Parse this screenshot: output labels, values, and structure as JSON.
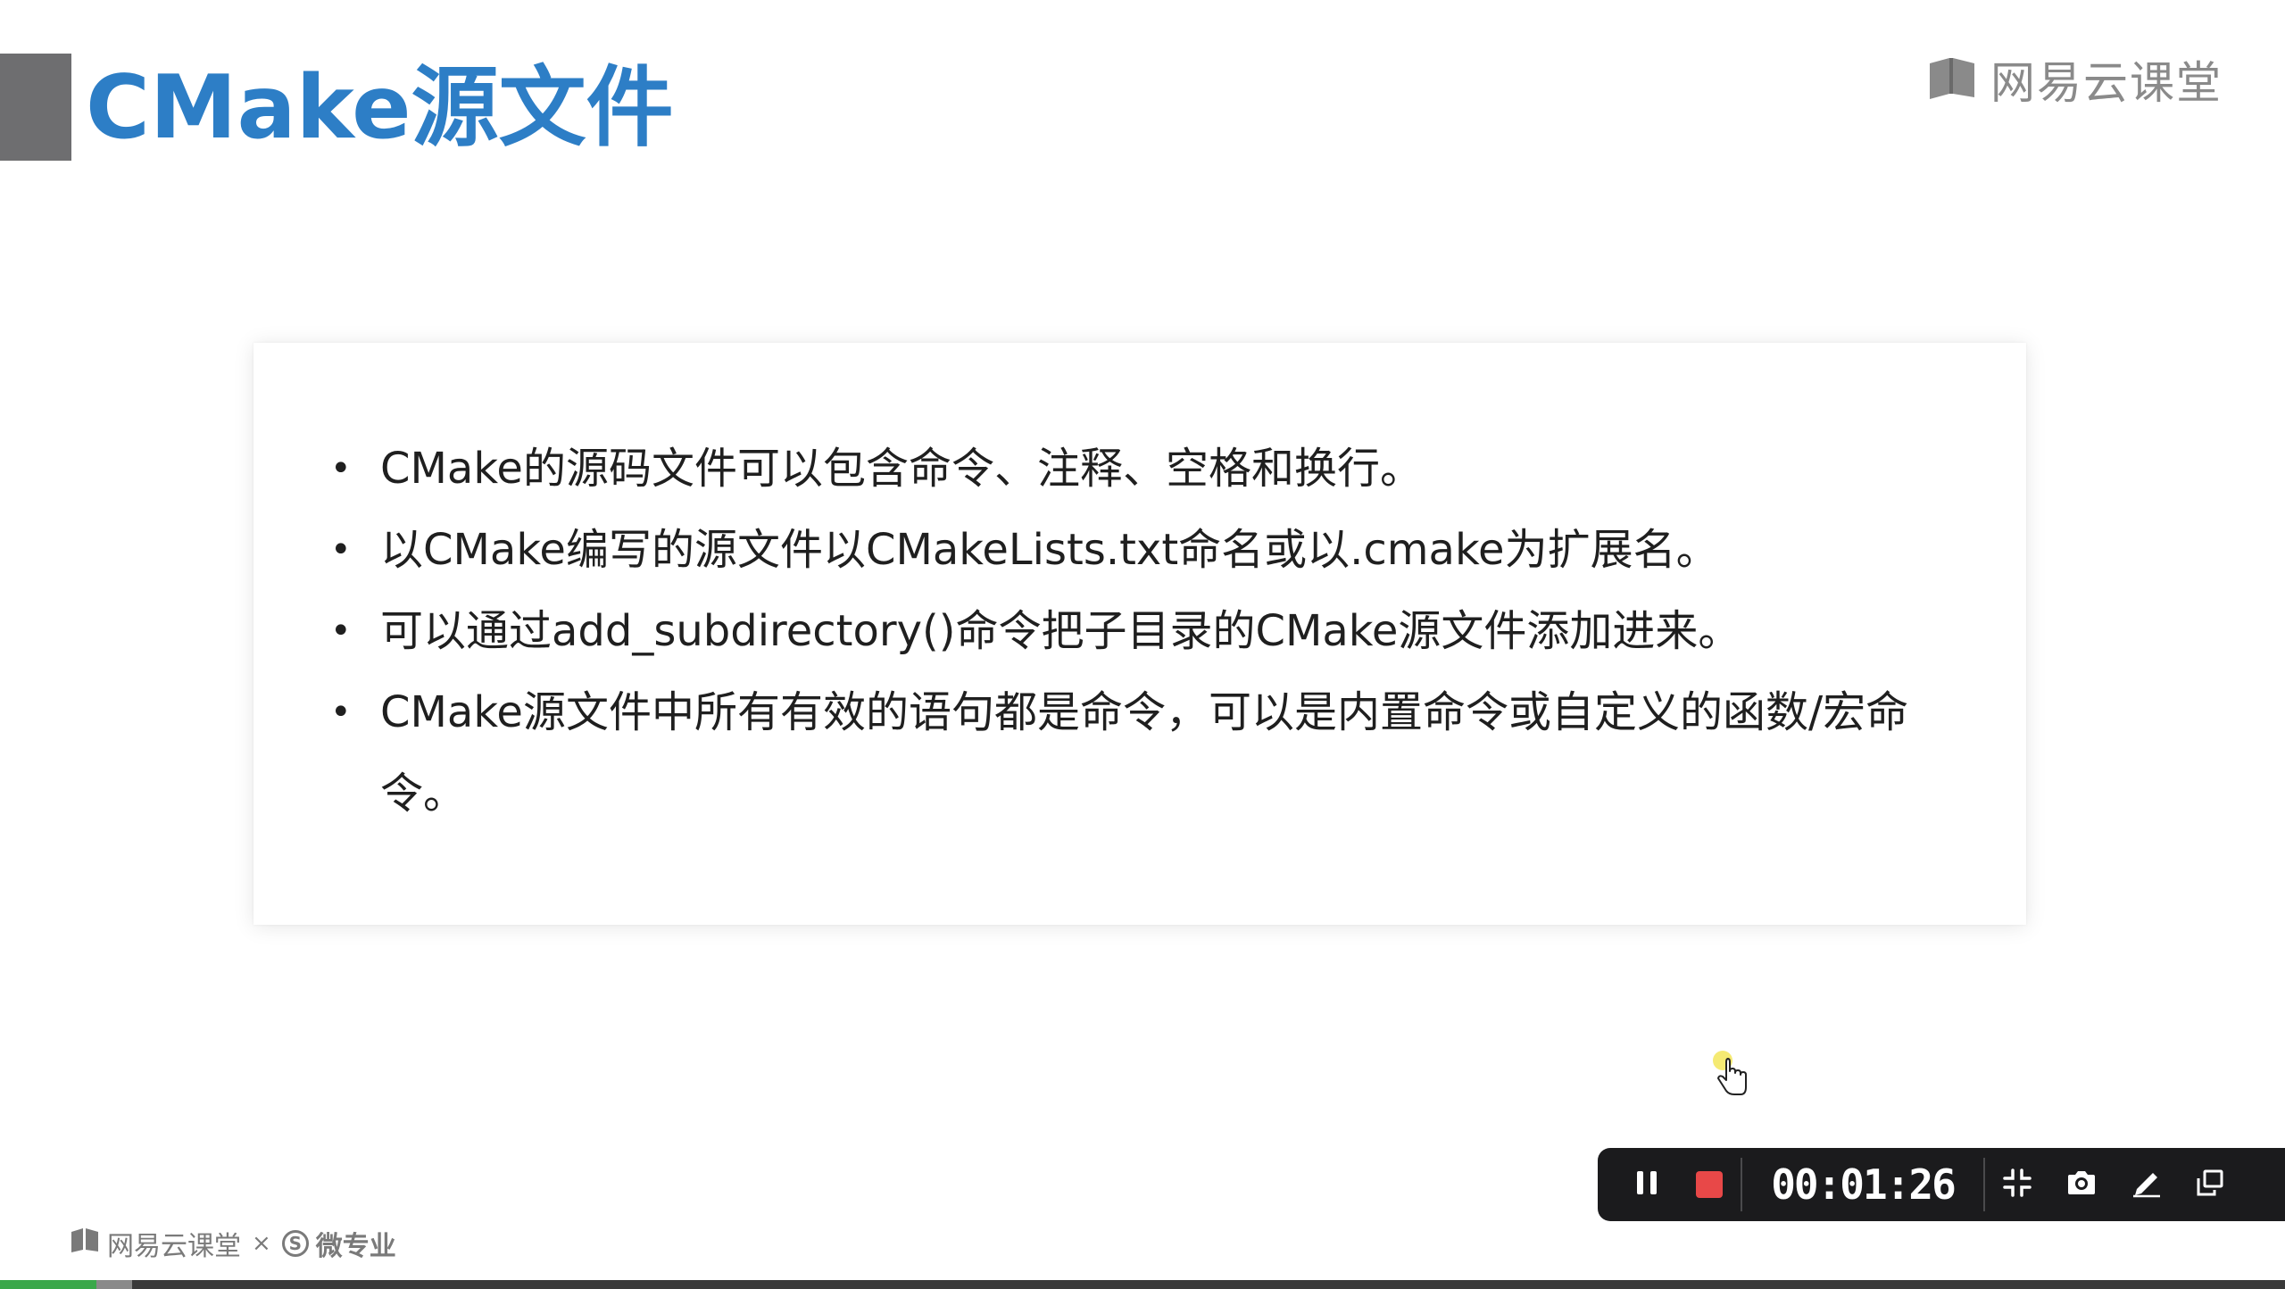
{
  "slide": {
    "title": "CMake源文件",
    "brand": "网易云课堂",
    "bullets": [
      "CMake的源码文件可以包含命令、注释、空格和换行。",
      "以CMake编写的源文件以CMakeLists.txt命名或以.cmake为扩展名。",
      "可以通过add_subdirectory()命令把子目录的CMake源文件添加进来。",
      "CMake源文件中所有有效的语句都是命令，可以是内置命令或自定义的函数/宏命令。"
    ],
    "accent_color": "#2d7ec6"
  },
  "recorder": {
    "timer": "00:01:26",
    "pause_icon": "pause-icon",
    "stop_icon": "stop-icon",
    "tools": [
      "collapse-icon",
      "camera-icon",
      "pen-icon",
      "window-icon"
    ]
  },
  "footer": {
    "brand": "网易云课堂",
    "separator": "×",
    "partner_symbol": "S",
    "partner": "微专业"
  },
  "progress": {
    "played_fraction": 0.042,
    "buffered_fraction": 0.058
  }
}
